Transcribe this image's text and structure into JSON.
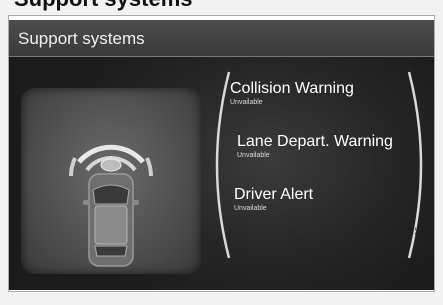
{
  "heading": "Support systems",
  "screen": {
    "title": "Support systems"
  },
  "items": [
    {
      "label": "Collision Warning",
      "status": "Unvailable"
    },
    {
      "label": "Lane Depart. Warning",
      "status": "Unvailable"
    },
    {
      "label": "Driver Alert",
      "status": "Unvailable"
    }
  ],
  "image_code": "G045296"
}
